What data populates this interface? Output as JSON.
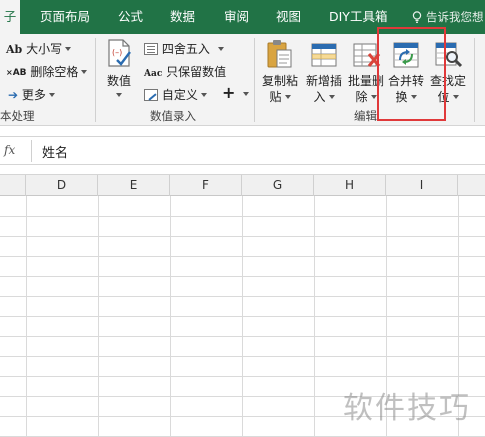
{
  "menubar": {
    "tabs": [
      {
        "label": "子",
        "active": true
      },
      {
        "label": "页面布局"
      },
      {
        "label": "公式"
      },
      {
        "label": "数据"
      },
      {
        "label": "审阅"
      },
      {
        "label": "视图"
      },
      {
        "label": "DIY工具箱"
      }
    ],
    "tell_me": "告诉我您想"
  },
  "ribbon": {
    "text_group": {
      "case_label": "大小写",
      "remove_spaces_label": "删除空格",
      "more_label": "更多",
      "group_label": "本处理"
    },
    "number_group": {
      "numeric_label": "数值",
      "round_label": "四舍五入",
      "keep_value_label": "只保留数值",
      "custom_label": "自定义",
      "group_label": "数值录入"
    },
    "edit_group": {
      "copy_paste": {
        "line1": "复制粘",
        "line2": "贴"
      },
      "add_insert": {
        "line1": "新增插",
        "line2": "入"
      },
      "batch_delete": {
        "line1": "批量删",
        "line2": "除"
      },
      "merge_convert": {
        "line1": "合并转",
        "line2": "换"
      },
      "find_locate": {
        "line1": "查找定",
        "line2": "位"
      },
      "group_label": "编辑"
    }
  },
  "formula_bar": {
    "fx_label": "fx",
    "value": "姓名"
  },
  "columns": [
    "D",
    "E",
    "F",
    "G",
    "H",
    "I"
  ],
  "watermark": "软件技巧",
  "colors": {
    "brand_green": "#217346",
    "highlight_red": "#e0393a"
  }
}
